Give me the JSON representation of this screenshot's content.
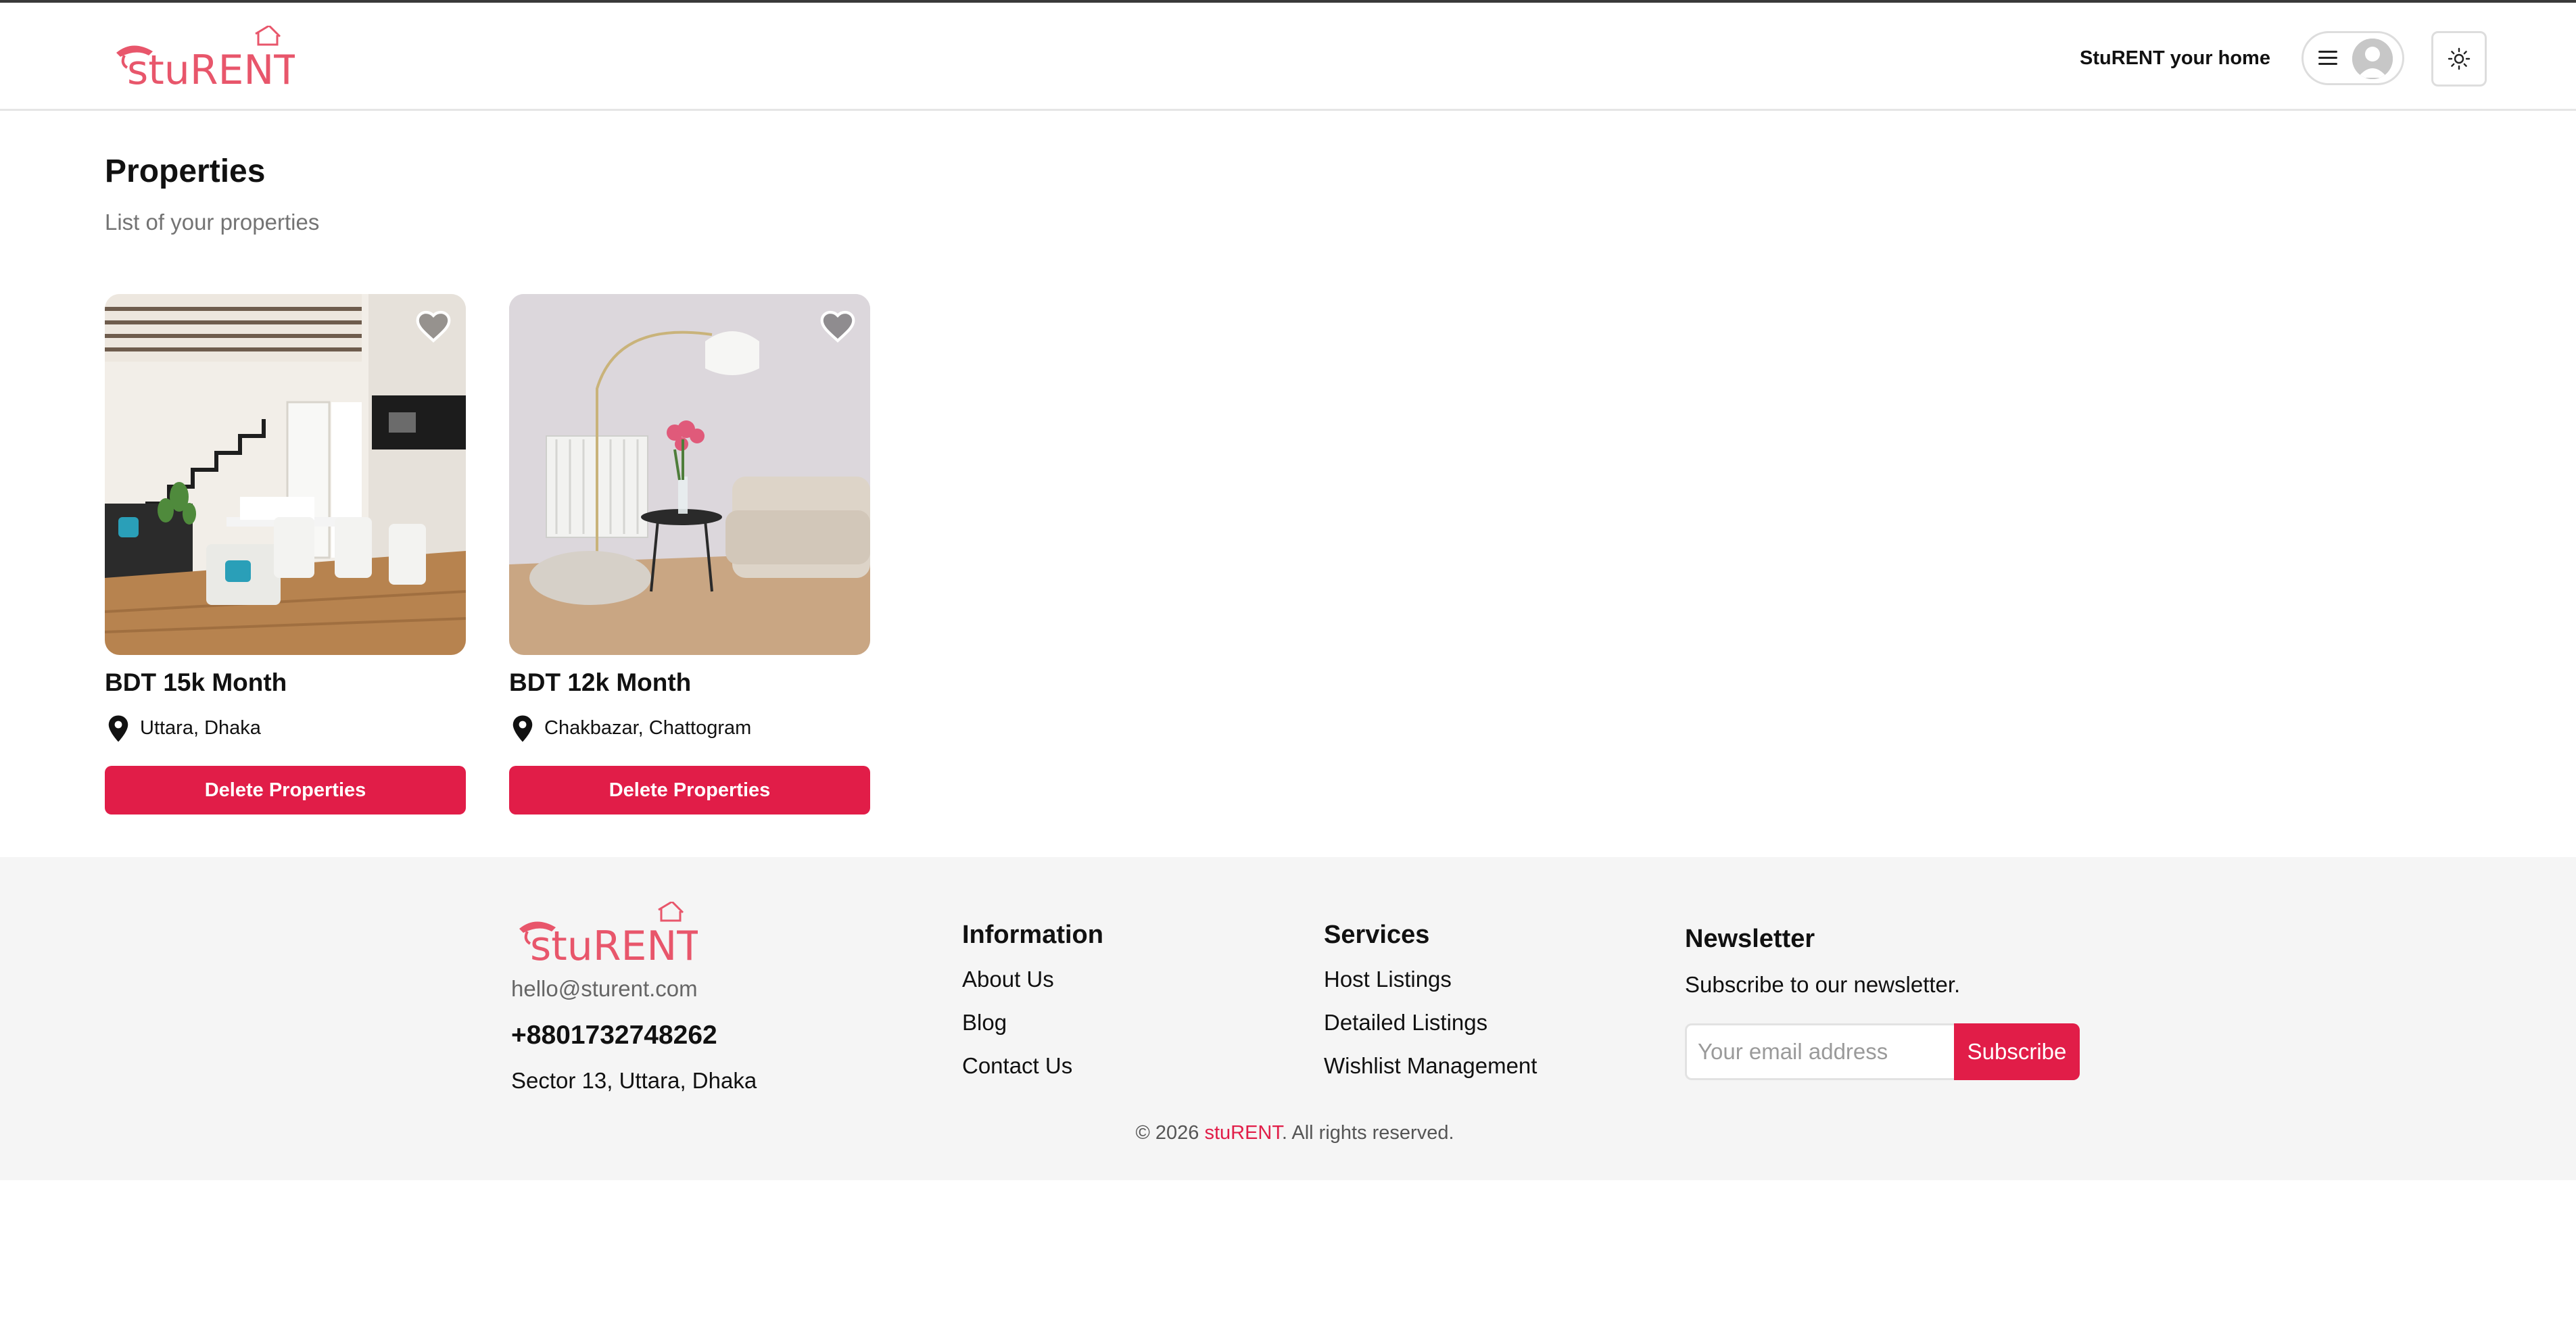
{
  "header": {
    "logo_text": "stuRENT",
    "tagline": "StuRENT your home"
  },
  "page": {
    "title": "Properties",
    "subtitle": "List of your properties"
  },
  "properties": [
    {
      "price": "BDT 15k Month",
      "location": "Uttara, Dhaka",
      "delete_label": "Delete Properties",
      "favorited": false
    },
    {
      "price": "BDT 12k Month",
      "location": "Chakbazar, Chattogram",
      "delete_label": "Delete Properties",
      "favorited": false
    }
  ],
  "footer": {
    "logo_text": "stuRENT",
    "email": "hello@sturent.com",
    "phone": "+8801732748262",
    "address": "Sector 13, Uttara, Dhaka",
    "information": {
      "title": "Information",
      "links": [
        "About Us",
        "Blog",
        "Contact Us"
      ]
    },
    "services": {
      "title": "Services",
      "links": [
        "Host Listings",
        "Detailed Listings",
        "Wishlist Management"
      ]
    },
    "newsletter": {
      "title": "Newsletter",
      "text": "Subscribe to our newsletter.",
      "placeholder": "Your email address",
      "button": "Subscribe"
    },
    "copyright": {
      "prefix": "© 2026 ",
      "brand": "stuRENT",
      "suffix": ". All rights reserved."
    }
  },
  "colors": {
    "accent": "#e11d48",
    "footer_bg": "#f5f5f5",
    "subtitle": "#737373"
  },
  "icons": [
    "hamburger-icon",
    "avatar-icon",
    "sun-icon",
    "heart-icon",
    "location-pin-icon"
  ]
}
